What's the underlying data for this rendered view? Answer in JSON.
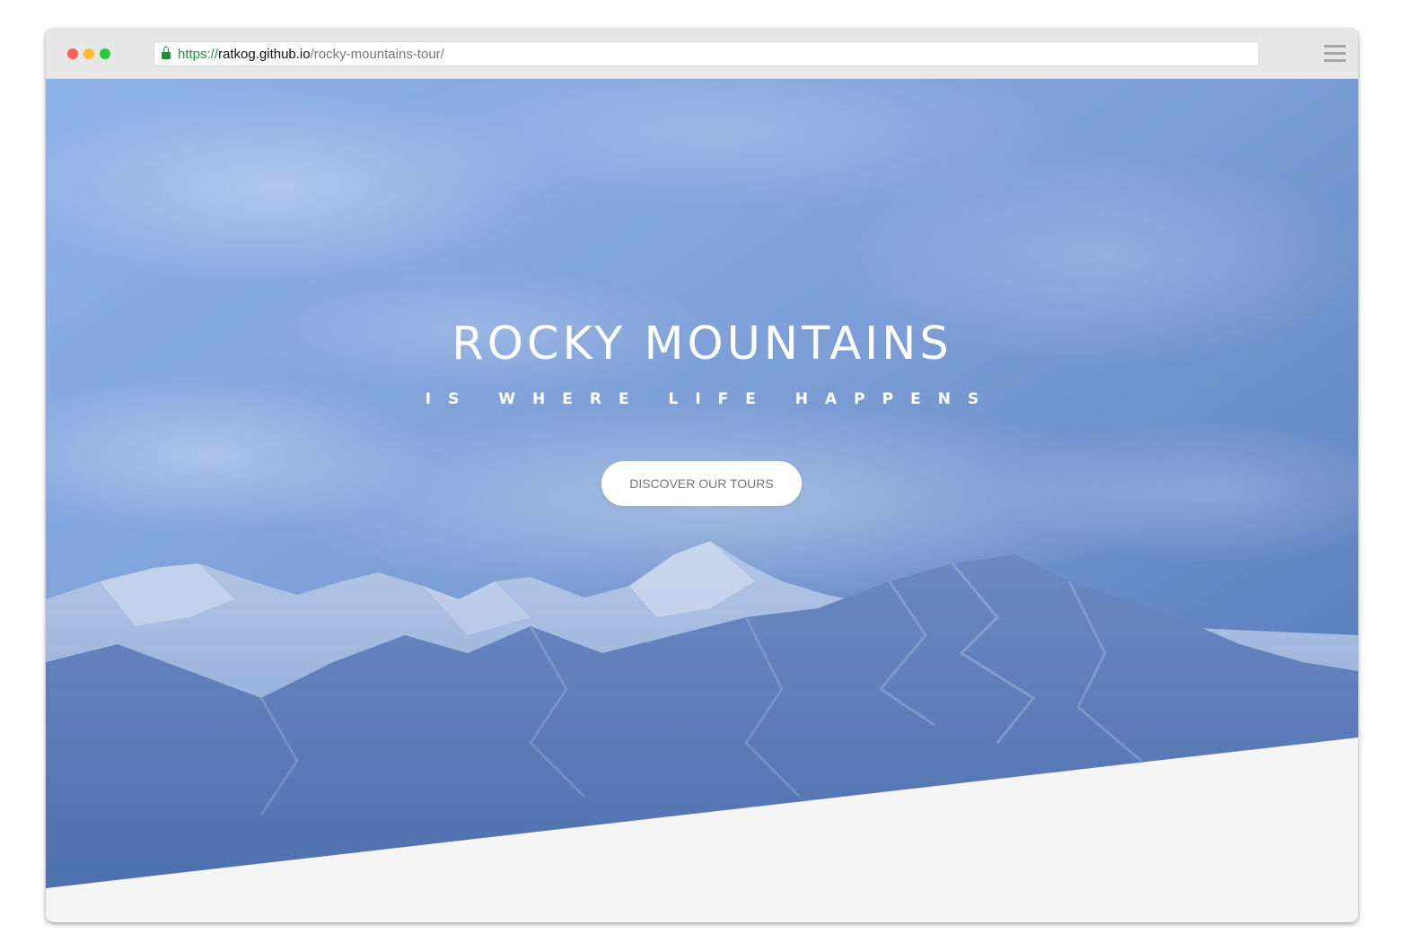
{
  "browser": {
    "url": {
      "scheme": "https://",
      "host": "ratkog.github.io",
      "path": "/rocky-mountains-tour/"
    }
  },
  "hero": {
    "title": "ROCKY MOUNTAINS",
    "subtitle": "IS WHERE LIFE HAPPENS",
    "cta_label": "DISCOVER OUR TOURS"
  },
  "colors": {
    "sky_light": "#9bbbeb",
    "sky_dark": "#5a7fbc",
    "section_bg": "#f5f5f6",
    "lock_green": "#1e8e3e"
  },
  "icons": [
    "lock-icon",
    "menu-icon"
  ]
}
